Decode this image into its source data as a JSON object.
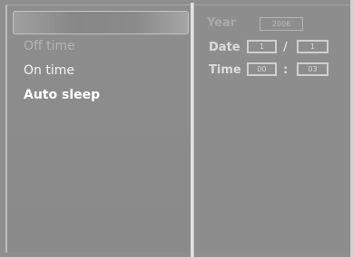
{
  "menu": {
    "items": [
      {
        "label": "Off time",
        "state": "faded"
      },
      {
        "label": "On time",
        "state": "normal"
      },
      {
        "label": "Auto sleep",
        "state": "active"
      }
    ]
  },
  "settings": {
    "year": {
      "label": "Year",
      "value": "2006"
    },
    "date": {
      "label": "Date",
      "month": "1",
      "separator": "/",
      "day": "1"
    },
    "time": {
      "label": "Time",
      "hour": "00",
      "separator": ":",
      "minute": "03"
    }
  },
  "colors": {
    "background": "#8e8e8e",
    "text": "#f0f0f0",
    "dim_text": "#b4b4b4",
    "box_border": "#cfcfcf"
  }
}
